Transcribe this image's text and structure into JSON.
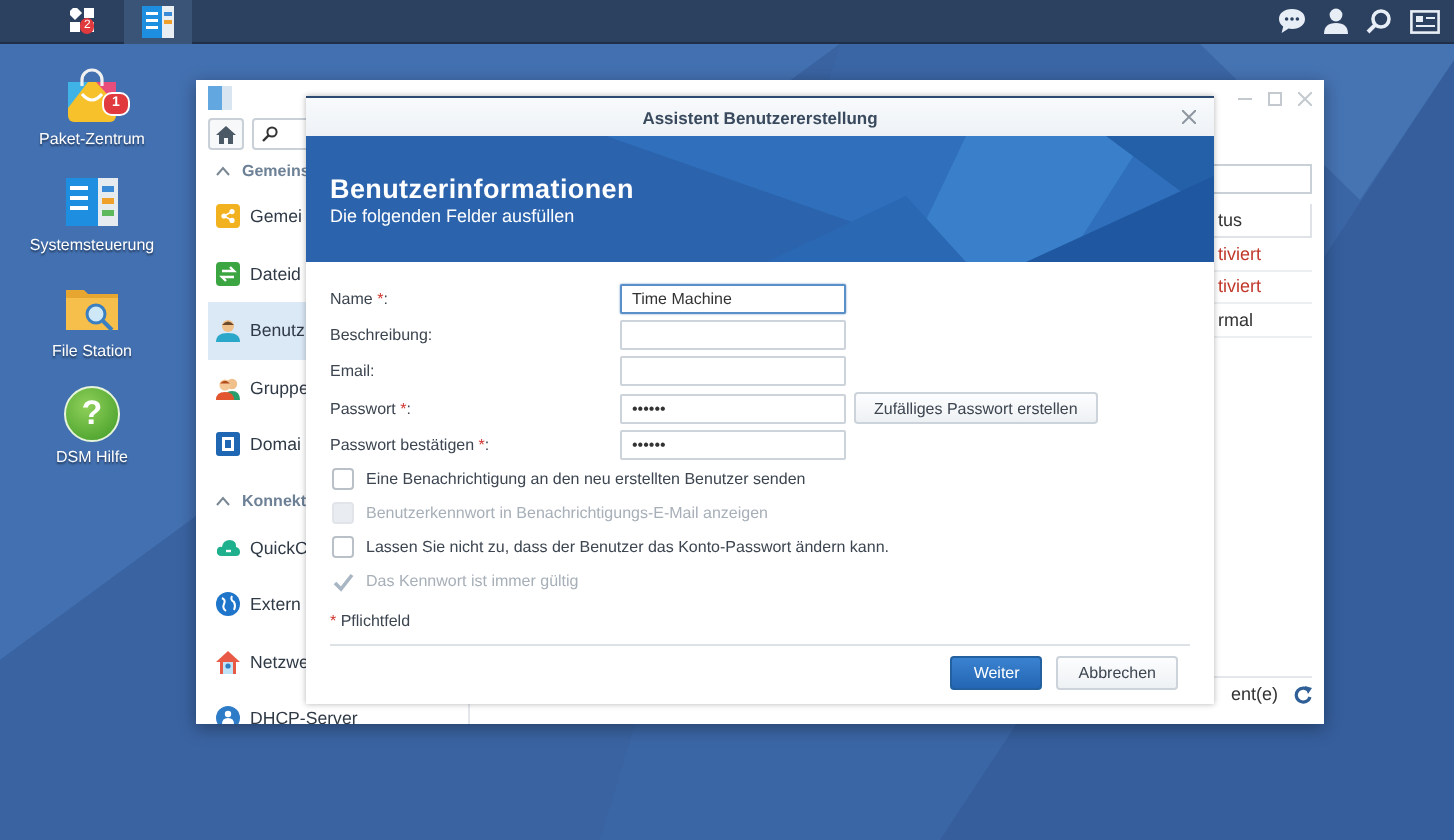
{
  "taskbar": {
    "main_menu": {
      "badge": "2"
    },
    "apps": [
      {
        "selected": true
      }
    ]
  },
  "desktop_icons": [
    {
      "label": "Paket-Zentrum",
      "badge": "1"
    },
    {
      "label": "Systemsteuerung"
    },
    {
      "label": "File Station"
    },
    {
      "label": "DSM Hilfe",
      "glyph": "?"
    }
  ],
  "background_window": {
    "sidebar": [
      {
        "title": "Gemeins",
        "expanded": true,
        "items": [
          {
            "label": "Gemei",
            "selected": false
          },
          {
            "label": "Dateid",
            "selected": false
          },
          {
            "label": "Benutz",
            "selected": true
          },
          {
            "label": "Gruppe",
            "selected": false
          },
          {
            "label": "Domai",
            "selected": false
          }
        ]
      },
      {
        "title": "Konnekt",
        "expanded": true,
        "items": [
          {
            "label": "QuickC",
            "selected": false
          },
          {
            "label": "Extern",
            "selected": false
          },
          {
            "label": "Netzwe",
            "selected": false
          },
          {
            "label": "DHCP-Server",
            "selected": false
          }
        ]
      }
    ],
    "status_column": {
      "header": "tus",
      "rows": [
        {
          "text": "tiviert",
          "alert": true
        },
        {
          "text": "tiviert",
          "alert": true
        },
        {
          "text": "rmal",
          "alert": false
        }
      ]
    },
    "footer": "ent(e)"
  },
  "dialog": {
    "title": "Assistent Benutzererstellung",
    "heading": "Benutzerinformationen",
    "subheading": "Die folgenden Felder ausfüllen",
    "fields": [
      {
        "label": "Name",
        "mark": "*",
        "colon": ":",
        "value": "Time Machine",
        "focused": true
      },
      {
        "label": "Beschreibung",
        "colon": ":",
        "focused": false
      },
      {
        "label": "Email",
        "colon": ":",
        "focused": false
      },
      {
        "label": "Passwort",
        "mark": "*",
        "colon": ":",
        "value": "••••••",
        "focused": false
      },
      {
        "label": "Passwort bestätigen",
        "mark": "*",
        "colon": ":",
        "value": "••••••",
        "focused": false
      }
    ],
    "generate_button": "Zufälliges Passwort erstellen",
    "options": [
      {
        "label": "Eine Benachrichtigung an den neu erstellten Benutzer senden",
        "checked": false,
        "disabled": false
      },
      {
        "label": "Benutzerkennwort in Benachrichtigungs-E-Mail anzeigen",
        "checked": false,
        "disabled": true
      },
      {
        "label": "Lassen Sie nicht zu, dass der Benutzer das Konto-Passwort ändern kann.",
        "checked": false,
        "disabled": false
      },
      {
        "label": "Das Kennwort ist immer gültig",
        "checked": true,
        "disabled": true
      }
    ],
    "required_note": {
      "mark": "*",
      "text": "Pflichtfeld"
    },
    "buttons": [
      {
        "label": "Weiter",
        "kind": "primary"
      },
      {
        "label": "Abbrechen",
        "kind": "secondary"
      }
    ]
  }
}
